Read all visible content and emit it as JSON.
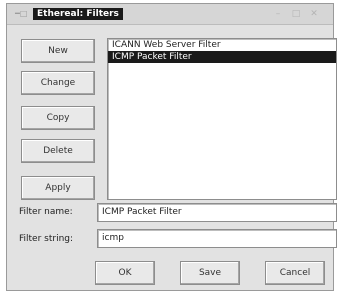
{
  "window": {
    "title": "Ethereal: Filters",
    "menu_icon": "menu-icon",
    "controls": [
      "minimize-icon",
      "maximize-icon",
      "close-icon"
    ]
  },
  "buttons": {
    "new": "New",
    "change": "Change",
    "copy": "Copy",
    "delete": "Delete",
    "apply": "Apply"
  },
  "filter_list": {
    "items": [
      {
        "label": "ICANN Web Server Filter",
        "selected": false
      },
      {
        "label": "ICMP Packet Filter",
        "selected": true
      }
    ]
  },
  "fields": {
    "name_label": "Filter name:",
    "name_value": "ICMP Packet Filter",
    "string_label": "Filter string:",
    "string_value": "icmp"
  },
  "footer": {
    "ok": "OK",
    "save": "Save",
    "cancel": "Cancel"
  },
  "colors": {
    "selection_bg": "#1a1a1a",
    "selection_fg": "#ffffff",
    "window_bg": "#e2e2e2"
  }
}
